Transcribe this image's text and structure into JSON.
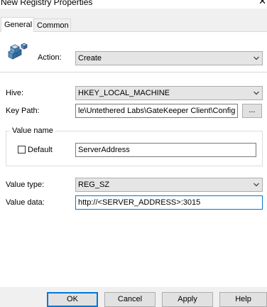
{
  "window": {
    "title": "New Registry Properties",
    "close_glyph": "✕"
  },
  "tabs": [
    {
      "label": "General",
      "selected": true
    },
    {
      "label": "Common",
      "selected": false
    }
  ],
  "general": {
    "icon": "registry-cubes-icon",
    "action_label": "Action:",
    "action_value": "Create",
    "hive_label": "Hive:",
    "hive_value": "HKEY_LOCAL_MACHINE",
    "key_path_label": "Key Path:",
    "key_path_value": "le\\Untethered Labs\\GateKeeper Client\\Config",
    "browse_label": "...",
    "value_name_group": "Value name",
    "default_label": "Default",
    "default_checked": false,
    "value_name_value": "ServerAddress",
    "value_type_label": "Value type:",
    "value_type_value": "REG_SZ",
    "value_data_label": "Value data:",
    "value_data_value": "http://<SERVER_ADDRESS>:3015"
  },
  "buttons": {
    "ok": "OK",
    "cancel": "Cancel",
    "apply": "Apply",
    "help": "Help"
  },
  "colors": {
    "accent": "#0078d7",
    "panel": "#ffffff",
    "chrome": "#f0f0f0"
  }
}
